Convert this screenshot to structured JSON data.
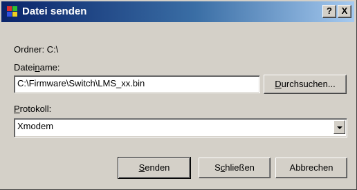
{
  "window": {
    "title": "Datei senden",
    "help_label": "?",
    "close_label": "X"
  },
  "folder": {
    "label": "Ordner: C:\\"
  },
  "filename": {
    "label_before": "Datei",
    "label_mnemonic": "n",
    "label_after": "ame:",
    "value": "C:\\Firmware\\Switch\\LMS_xx.bin"
  },
  "browse_button": {
    "mnemonic": "D",
    "rest": "urchsuchen..."
  },
  "protocol": {
    "label_mnemonic": "P",
    "label_after": "rotokoll:",
    "selected": "Xmodem"
  },
  "buttons": {
    "send_mnemonic": "S",
    "send_rest": "enden",
    "close_before": "S",
    "close_mnemonic": "c",
    "close_after": "hließen",
    "cancel": "Abbrechen"
  }
}
